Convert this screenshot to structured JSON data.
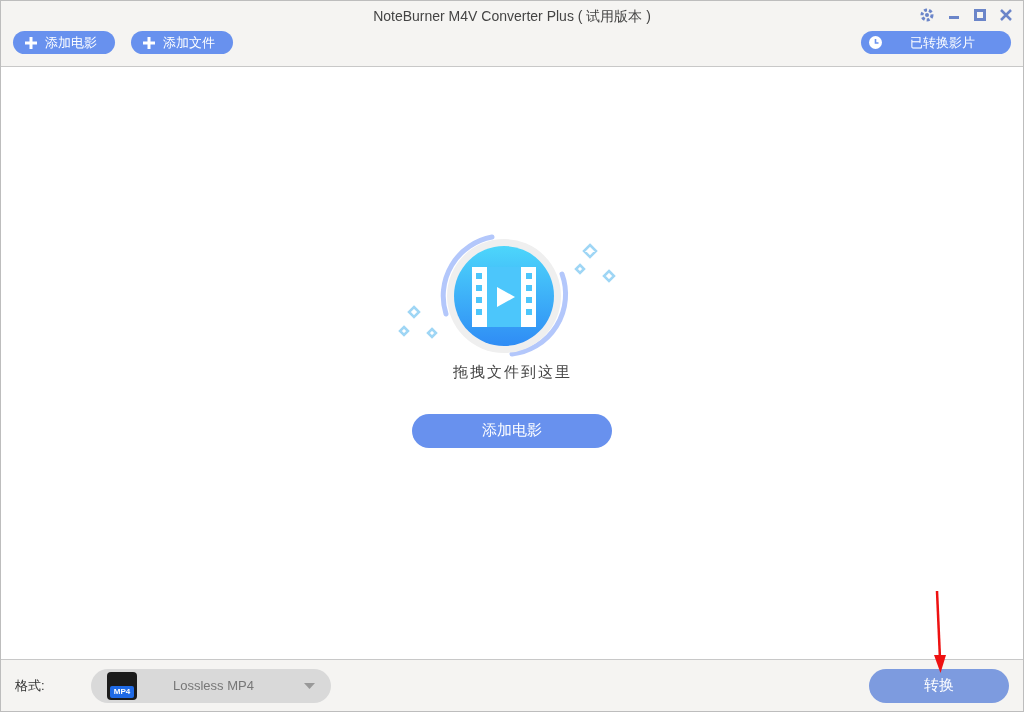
{
  "window": {
    "title": "NoteBurner M4V Converter Plus ( 试用版本 )"
  },
  "toolbar": {
    "buttons": [
      "添加电影",
      "添加文件"
    ],
    "history_button": "已转换影片"
  },
  "drop_area": {
    "hint": "拖拽文件到这里",
    "button": "添加电影"
  },
  "footer": {
    "format_label": "格式:",
    "format": {
      "icon_text": "MP4",
      "value": "Lossless MP4"
    },
    "convert_button": "转换"
  }
}
